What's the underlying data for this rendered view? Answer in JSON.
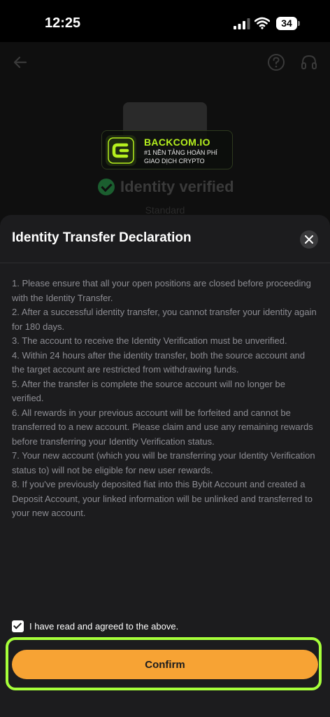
{
  "status_bar": {
    "time": "12:25",
    "battery": "34",
    "icons": [
      "signal-icon",
      "wifi-icon",
      "battery-icon"
    ]
  },
  "background_page": {
    "icons": [
      "back-arrow-icon",
      "help-icon",
      "support-headset-icon"
    ],
    "verification_status": "Identity verified",
    "verification_level": "Standard"
  },
  "watermark": {
    "brand": "BACKCOM.IO",
    "tagline_1": "#1 NỀN TẢNG HOÀN PHÍ",
    "tagline_2": "GIAO DỊCH CRYPTO"
  },
  "sheet": {
    "title": "Identity Transfer Declaration",
    "terms": [
      "1. Please ensure that all your open positions are closed before proceeding with the Identity Transfer.",
      "2. After a successful identity transfer, you cannot transfer your identity again for 180 days.",
      "3. The account to receive the Identity Verification must be unverified.",
      "4. Within 24 hours after the identity transfer, both the source account and the target account are restricted from withdrawing funds.",
      "5. After the transfer is complete the source account will no longer be verified.",
      "6. All rewards in your previous account will be forfeited and cannot be transferred to a new account. Please claim and use any remaining rewards before transferring your Identity Verification status.",
      "7. Your new account (which you will be transferring your Identity Verification status to) will not be eligible for new user rewards.",
      "8. If you've previously deposited fiat into this Bybit Account and created a Deposit Account, your linked information will be unlinked and transferred to your new account."
    ],
    "agree_label": "I have read and agreed to the above.",
    "agree_checked": true,
    "confirm_label": "Confirm"
  },
  "colors": {
    "accent": "#f7a334",
    "highlight": "#a6ff3a",
    "sheet_bg": "#1c1c1e",
    "text_muted": "#8d8d93"
  }
}
